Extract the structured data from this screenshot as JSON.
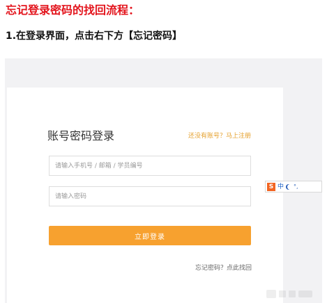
{
  "document": {
    "title": "忘记登录密码的找回流程：",
    "step_1": "1.在登录界面，点击右下方【忘记密码】"
  },
  "login": {
    "title": "账号密码登录",
    "register_link": "还没有账号？马上注册",
    "account_placeholder": "请输入手机号 / 邮箱 / 学员编号",
    "password_placeholder": "请输入密码",
    "login_button": "立即登录",
    "forgot_link": "忘记密码？点此找回"
  },
  "ime_toolbar": {
    "logo_icon": "sogou-s-icon",
    "logo_text": "S",
    "mode": "中",
    "moon_icon": "moon-icon",
    "punctuation": "°,"
  },
  "colors": {
    "title_red": "#e3141c",
    "accent_orange": "#f7a12f",
    "register_link_orange": "#e5a12e",
    "background_gray": "#f2f2f4"
  }
}
